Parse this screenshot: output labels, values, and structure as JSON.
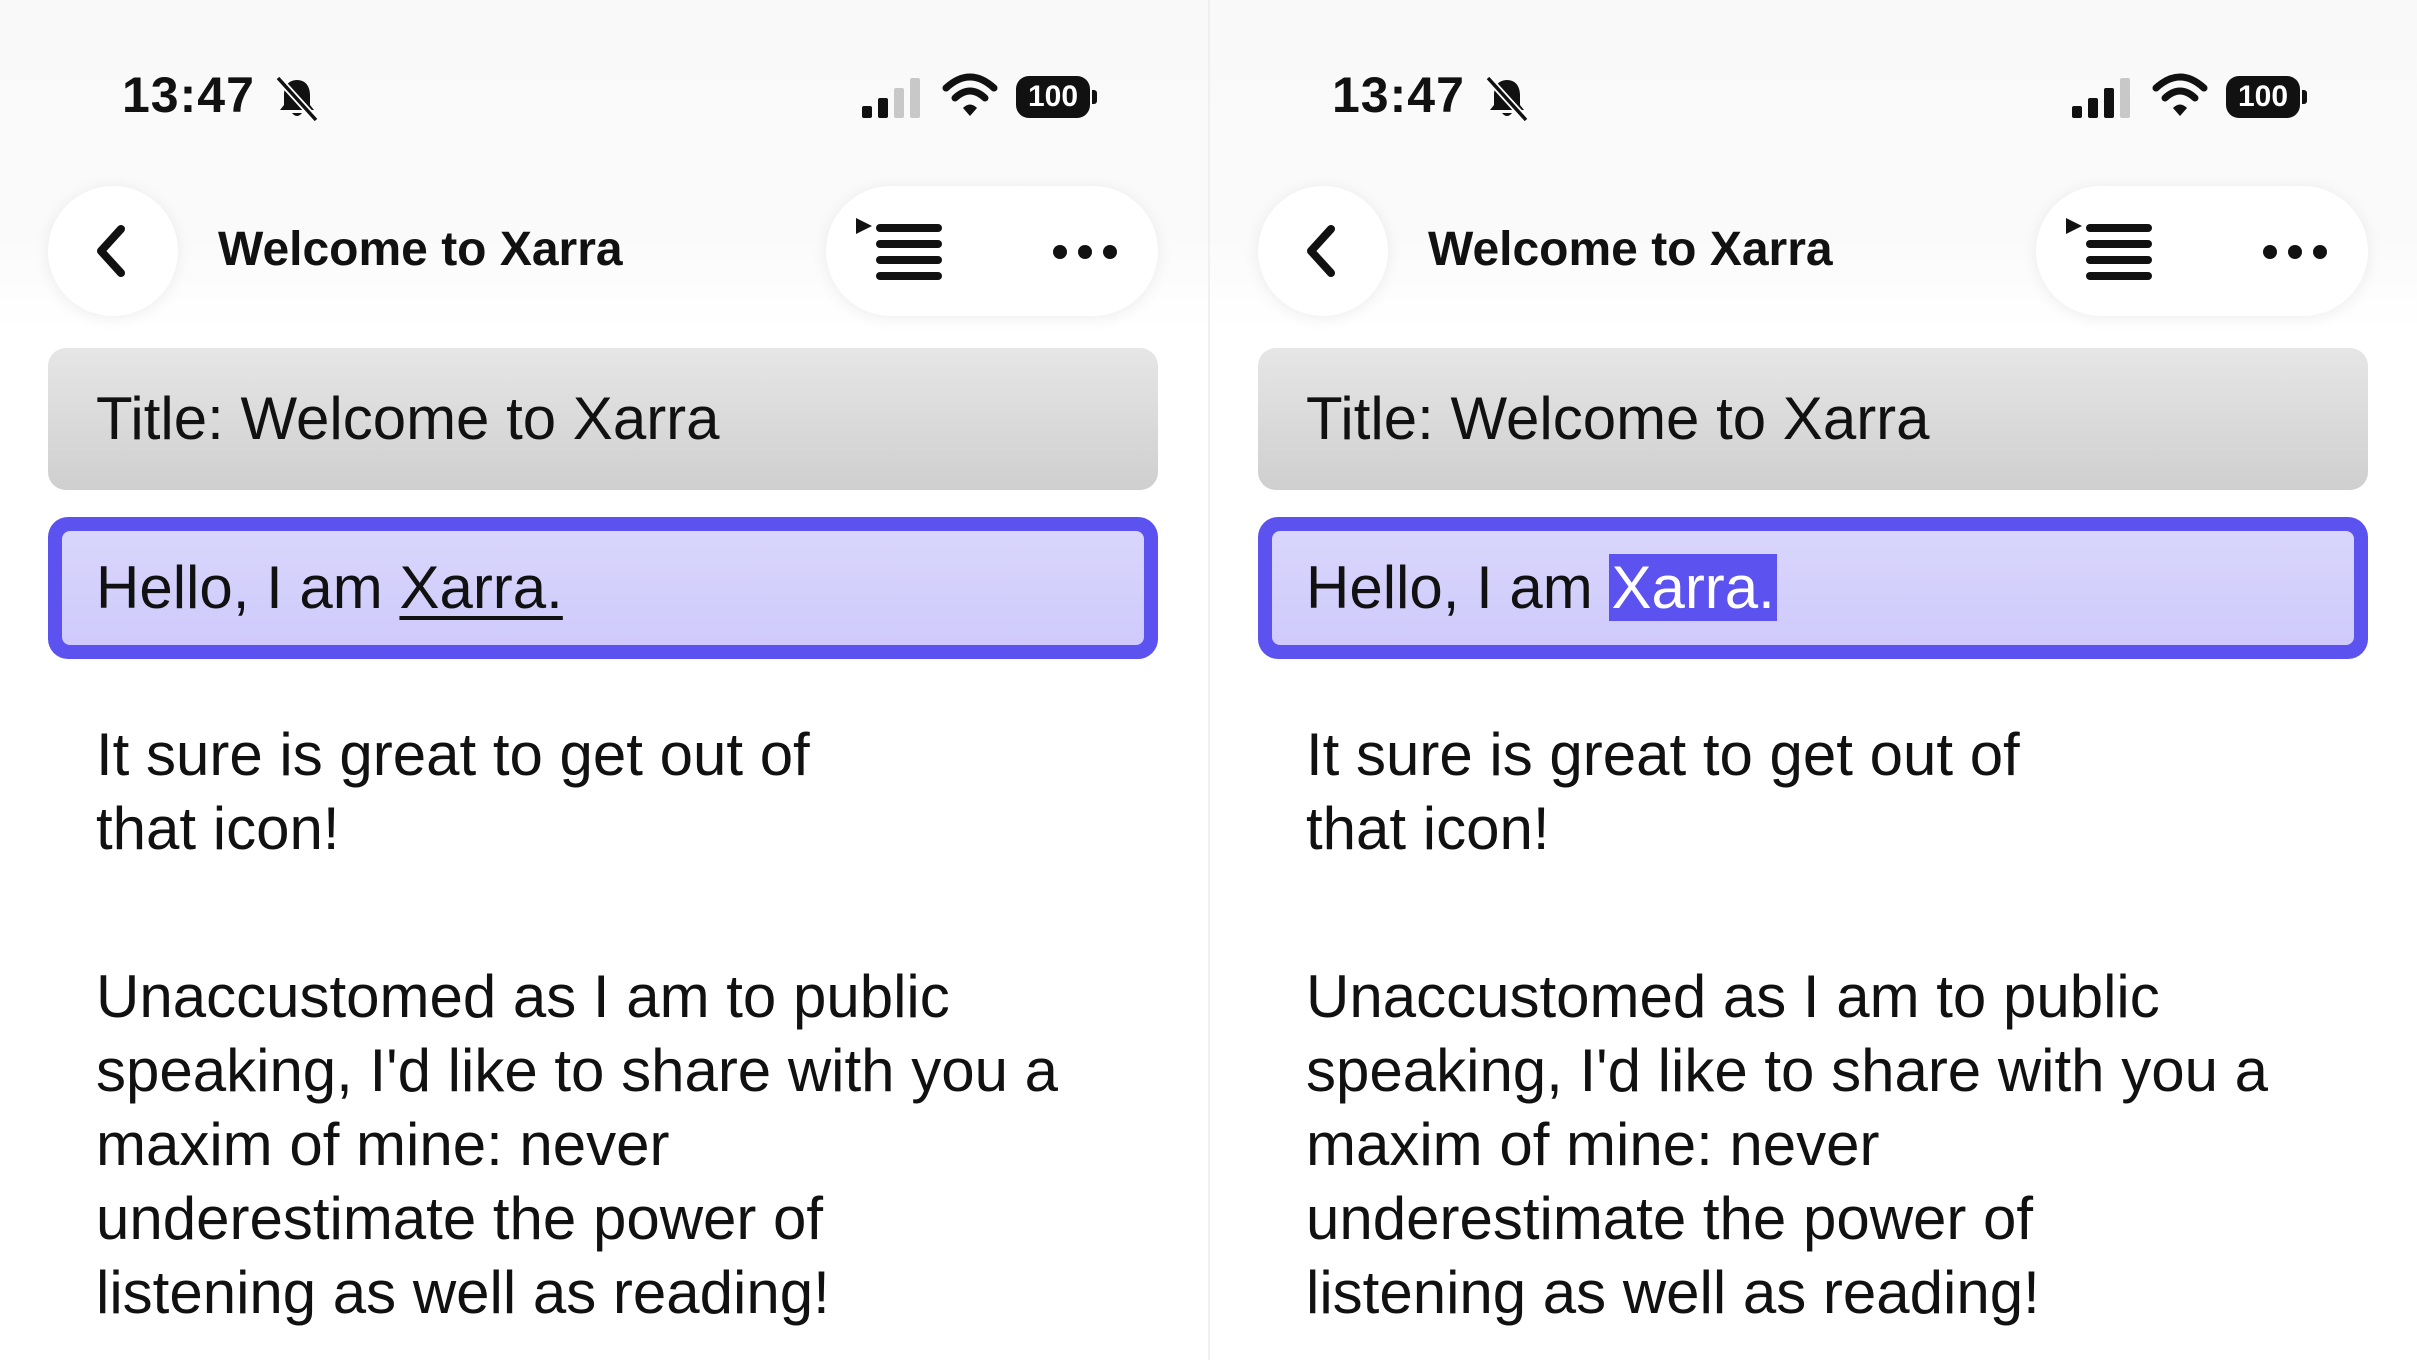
{
  "screens": [
    {
      "status_bar": {
        "time": "13:47",
        "battery_level": "100",
        "icons": [
          "bell-slash-icon",
          "cellular-signal-icon",
          "wifi-icon",
          "battery-icon"
        ]
      },
      "nav": {
        "back_icon": "chevron-left-icon",
        "title": "Welcome to Xarra",
        "listen_icon": "play-list-icon",
        "more_icon": "ellipsis-icon"
      },
      "title_block": {
        "text": "Title: Welcome to Xarra"
      },
      "active_block": {
        "prefix": "Hello, I am ",
        "current_word": "Xarra.",
        "word_style": "underline"
      },
      "paragraphs": [
        {
          "lines": [
            "It sure is great to get out of",
            "that icon!"
          ]
        },
        {
          "lines": [
            "Unaccustomed as I am to public",
            "speaking, I'd like to share with you a",
            "maxim of mine: never",
            "underestimate the power of",
            "listening as well as reading!"
          ]
        }
      ]
    },
    {
      "status_bar": {
        "time": "13:47",
        "battery_level": "100",
        "icons": [
          "bell-slash-icon",
          "cellular-signal-icon",
          "wifi-icon",
          "battery-icon"
        ]
      },
      "nav": {
        "back_icon": "chevron-left-icon",
        "title": "Welcome to Xarra",
        "listen_icon": "play-list-icon",
        "more_icon": "ellipsis-icon"
      },
      "title_block": {
        "text": "Title: Welcome to Xarra"
      },
      "active_block": {
        "prefix": "Hello, I am ",
        "current_word": "Xarra.",
        "word_style": "selected"
      },
      "paragraphs": [
        {
          "lines": [
            "It sure is great to get out of",
            "that icon!"
          ]
        },
        {
          "lines": [
            "Unaccustomed as I am to public",
            "speaking, I'd like to share with you a",
            "maxim of mine: never",
            "underestimate the power of",
            "listening as well as reading!"
          ]
        }
      ]
    }
  ],
  "colors": {
    "accent": "#5b52ef",
    "active_fill": "#d7d3fc",
    "title_block": "#d9d9d9",
    "text": "#111111"
  }
}
